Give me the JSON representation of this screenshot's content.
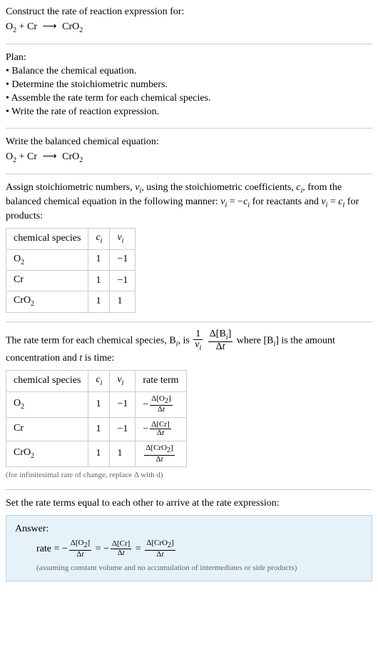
{
  "prompt": {
    "line1": "Construct the rate of reaction expression for:",
    "eq_lhs_a": "O",
    "eq_lhs_a_sub": "2",
    "eq_plus": " + Cr ",
    "eq_arrow": "⟶",
    "eq_rhs": " CrO",
    "eq_rhs_sub": "2"
  },
  "plan": {
    "heading": "Plan:",
    "b1": "• Balance the chemical equation.",
    "b2": "• Determine the stoichiometric numbers.",
    "b3": "• Assemble the rate term for each chemical species.",
    "b4": "• Write the rate of reaction expression."
  },
  "balanced": {
    "heading": "Write the balanced chemical equation:",
    "lhs_a": "O",
    "lhs_a_sub": "2",
    "plus": " + Cr ",
    "arrow": "⟶",
    "rhs": " CrO",
    "rhs_sub": "2"
  },
  "assign": {
    "text_a": "Assign stoichiometric numbers, ",
    "nu": "ν",
    "sub_i": "i",
    "text_b": ", using the stoichiometric coefficients, ",
    "c": "c",
    "text_c": ", from the balanced chemical equation in the following manner: ",
    "eq1_lhs": "ν",
    "eq1_eq": " = −",
    "eq1_rhs": "c",
    "text_d": " for reactants and ",
    "eq2_lhs": "ν",
    "eq2_eq": " = ",
    "eq2_rhs": "c",
    "text_e": " for products:"
  },
  "table1": {
    "h1": "chemical species",
    "h2": "c",
    "h2_sub": "i",
    "h3": "ν",
    "h3_sub": "i",
    "rows": [
      {
        "sp_a": "O",
        "sp_sub": "2",
        "c": "1",
        "nu": "−1"
      },
      {
        "sp_a": "Cr",
        "sp_sub": "",
        "c": "1",
        "nu": "−1"
      },
      {
        "sp_a": "CrO",
        "sp_sub": "2",
        "c": "1",
        "nu": "1"
      }
    ]
  },
  "rateterm": {
    "text_a": "The rate term for each chemical species, B",
    "sub_i": "i",
    "text_b": ", is ",
    "frac1_num": "1",
    "frac1_den_a": "ν",
    "frac1_den_sub": "i",
    "frac2_num_a": "Δ[B",
    "frac2_num_sub": "i",
    "frac2_num_b": "]",
    "frac2_den": "Δt",
    "text_c": " where [B",
    "text_d": "] is the amount concentration and ",
    "t": "t",
    "text_e": " is time:"
  },
  "table2": {
    "h1": "chemical species",
    "h2": "c",
    "h2_sub": "i",
    "h3": "ν",
    "h3_sub": "i",
    "h4": "rate term",
    "rows": [
      {
        "sp_a": "O",
        "sp_sub": "2",
        "c": "1",
        "nu": "−1",
        "neg": "−",
        "num": "Δ[O",
        "num_sub": "2",
        "num_b": "]",
        "den": "Δt"
      },
      {
        "sp_a": "Cr",
        "sp_sub": "",
        "c": "1",
        "nu": "−1",
        "neg": "−",
        "num": "Δ[Cr]",
        "num_sub": "",
        "num_b": "",
        "den": "Δt"
      },
      {
        "sp_a": "CrO",
        "sp_sub": "2",
        "c": "1",
        "nu": "1",
        "neg": "",
        "num": "Δ[CrO",
        "num_sub": "2",
        "num_b": "]",
        "den": "Δt"
      }
    ],
    "note": "(for infinitesimal rate of change, replace Δ with d)"
  },
  "final": {
    "heading": "Set the rate terms equal to each other to arrive at the rate expression:",
    "answer_label": "Answer:",
    "rate": "rate = −",
    "f1_num": "Δ[O",
    "f1_sub": "2",
    "f1_num_b": "]",
    "f1_den": "Δt",
    "eq": " = −",
    "f2_num": "Δ[Cr]",
    "f2_den": "Δt",
    "eq2": " = ",
    "f3_num": "Δ[CrO",
    "f3_sub": "2",
    "f3_num_b": "]",
    "f3_den": "Δt",
    "note": "(assuming constant volume and no accumulation of intermediates or side products)"
  }
}
